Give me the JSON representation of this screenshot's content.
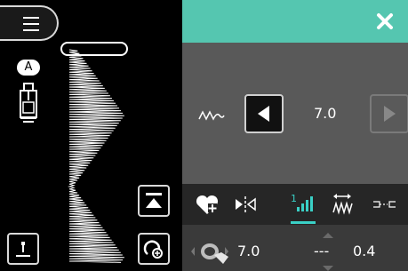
{
  "sidebar": {
    "mode_letter": "A"
  },
  "stitch": {
    "length_value": "7.0",
    "bottom_left_value": "7.0",
    "bottom_mid_value": "---",
    "bottom_right_value": "0.4"
  },
  "icons": {
    "menu": "hamburger-menu-icon",
    "close": "close-icon",
    "stitch_length": "zigzag-wave-icon",
    "decrease": "arrow-left-icon",
    "increase": "arrow-right-icon",
    "favorite": "heart-plus-icon",
    "mirror": "mirror-icon",
    "density": "bar-level-icon",
    "width": "stitch-width-icon",
    "tie_off": "tie-off-icon",
    "foot": "presser-foot-icon",
    "needle": "needle-position-icon",
    "top": "move-to-top-icon",
    "restart": "restart-pattern-icon"
  },
  "colors": {
    "accent": "#55c6b0",
    "panel": "#595959",
    "background": "#000000"
  }
}
